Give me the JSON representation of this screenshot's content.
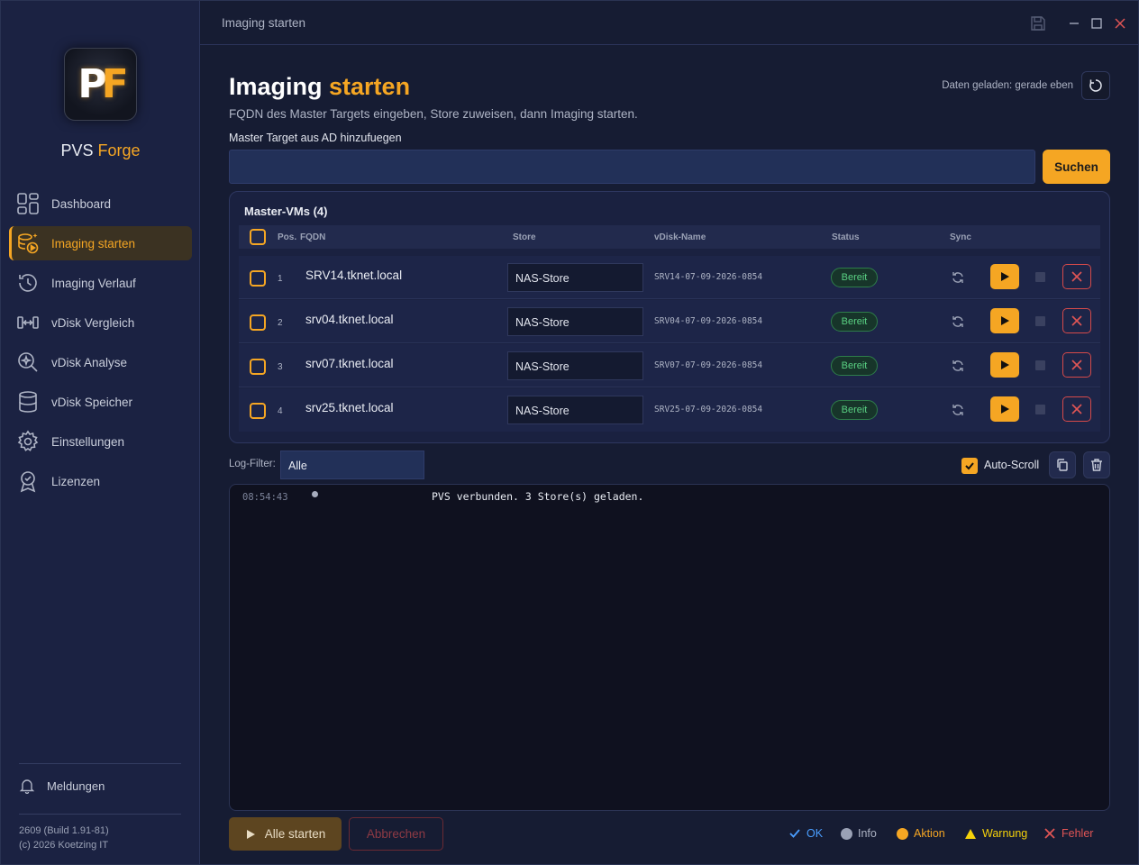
{
  "app": {
    "name_part1": "PVS",
    "name_part2": "Forge",
    "logo_text": "PF"
  },
  "sidebar": {
    "items": [
      {
        "label": "Dashboard",
        "icon": "dashboard-icon"
      },
      {
        "label": "Imaging starten",
        "icon": "imaging-start-icon",
        "active": true
      },
      {
        "label": "Imaging Verlauf",
        "icon": "history-icon"
      },
      {
        "label": "vDisk Vergleich",
        "icon": "compare-icon"
      },
      {
        "label": "vDisk Analyse",
        "icon": "analyze-icon"
      },
      {
        "label": "vDisk Speicher",
        "icon": "database-icon"
      },
      {
        "label": "Einstellungen",
        "icon": "gear-icon"
      },
      {
        "label": "Lizenzen",
        "icon": "license-icon"
      }
    ],
    "notifications": "Meldungen",
    "version": "2609 (Build 1.91-81)",
    "copyright": "(c) 2026 Koetzing IT"
  },
  "titlebar": {
    "title": "Imaging starten"
  },
  "page": {
    "title_part1": "Imaging",
    "title_part2": "starten",
    "subtitle": "FQDN des Master Targets eingeben, Store zuweisen, dann Imaging starten.",
    "loaded_status": "Daten geladen: gerade eben",
    "ad_label": "Master Target aus AD hinzufuegen",
    "ad_value": "",
    "search_button": "Suchen"
  },
  "table": {
    "title": "Master-VMs (4)",
    "headers": {
      "pos": "Pos.",
      "fqdn": "FQDN",
      "store": "Store",
      "vdisk": "vDisk-Name",
      "status": "Status",
      "sync": "Sync"
    },
    "rows": [
      {
        "pos": "1",
        "fqdn": "SRV14.tknet.local",
        "store": "NAS-Store",
        "vdisk": "SRV14-07-09-2026-0854",
        "status": "Bereit"
      },
      {
        "pos": "2",
        "fqdn": "srv04.tknet.local",
        "store": "NAS-Store",
        "vdisk": "SRV04-07-09-2026-0854",
        "status": "Bereit"
      },
      {
        "pos": "3",
        "fqdn": "srv07.tknet.local",
        "store": "NAS-Store",
        "vdisk": "SRV07-07-09-2026-0854",
        "status": "Bereit"
      },
      {
        "pos": "4",
        "fqdn": "srv25.tknet.local",
        "store": "NAS-Store",
        "vdisk": "SRV25-07-09-2026-0854",
        "status": "Bereit"
      }
    ]
  },
  "log": {
    "filter_label": "Log-Filter:",
    "filter_value": "Alle",
    "autoscroll_label": "Auto-Scroll",
    "autoscroll_checked": true,
    "entries": [
      {
        "time": "08:54:43",
        "message": "PVS verbunden. 3 Store(s) geladen."
      }
    ]
  },
  "footer": {
    "start_all": "Alle starten",
    "cancel": "Abbrechen",
    "legend": [
      {
        "label": "OK",
        "color": "#4a9eff"
      },
      {
        "label": "Info",
        "color": "#9aa1b5"
      },
      {
        "label": "Aktion",
        "color": "#f5a623"
      },
      {
        "label": "Warnung",
        "color": "#f5d20a"
      },
      {
        "label": "Fehler",
        "color": "#e05555"
      }
    ]
  },
  "colors": {
    "accent": "#f5a623",
    "background": "#161c33",
    "sidebar": "#1b2242",
    "ok_badge": "#5ad183",
    "danger": "#d64a4a"
  }
}
